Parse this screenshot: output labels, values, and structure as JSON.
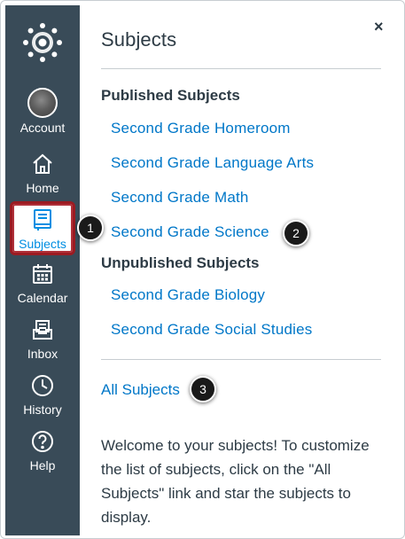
{
  "nav": {
    "items": [
      {
        "label": "Account",
        "icon": "avatar"
      },
      {
        "label": "Home",
        "icon": "home-icon"
      },
      {
        "label": "Subjects",
        "icon": "book-icon",
        "active": true
      },
      {
        "label": "Calendar",
        "icon": "calendar-icon"
      },
      {
        "label": "Inbox",
        "icon": "inbox-icon"
      },
      {
        "label": "History",
        "icon": "clock-icon"
      },
      {
        "label": "Help",
        "icon": "help-icon"
      }
    ]
  },
  "tray": {
    "title": "Subjects",
    "close_label": "×",
    "published_heading": "Published Subjects",
    "published": [
      "Second Grade Homeroom",
      "Second Grade Language Arts",
      "Second Grade Math",
      "Second Grade Science"
    ],
    "unpublished_heading": "Unpublished Subjects",
    "unpublished": [
      "Second Grade Biology",
      "Second Grade Social Studies"
    ],
    "all_link": "All Subjects",
    "welcome": "Welcome to your subjects! To customize the list of subjects, click on the \"All Subjects\" link and star the subjects to display."
  },
  "callouts": [
    "1",
    "2",
    "3"
  ],
  "colors": {
    "nav_bg": "#394b58",
    "link": "#0077c8",
    "active_border": "#9b1b22",
    "text": "#2d3b45"
  }
}
